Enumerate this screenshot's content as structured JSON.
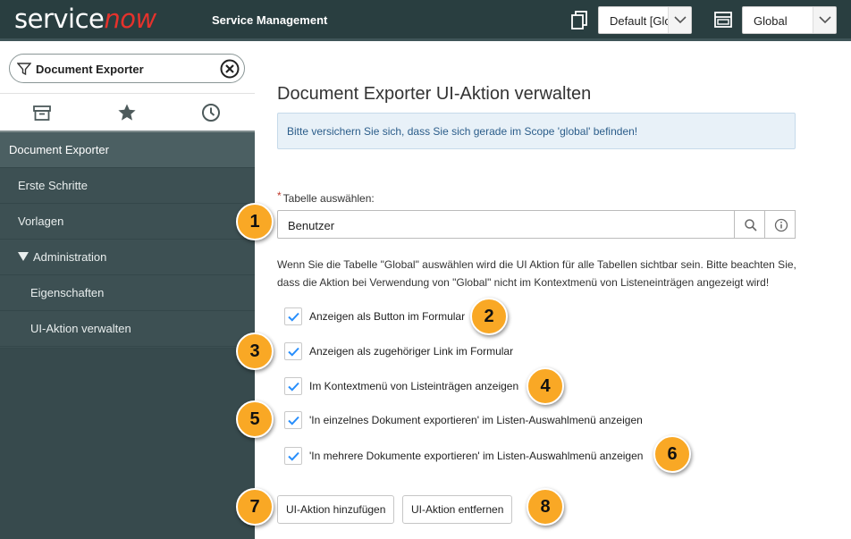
{
  "header": {
    "logo_prefix": "service",
    "logo_suffix": "now",
    "app_title": "Service Management",
    "update_set_value": "Default [Glo",
    "scope_value": "Global"
  },
  "sidebar": {
    "filter_value": "Document Exporter",
    "tabs": [
      "archive-icon",
      "favorites-star-icon",
      "history-clock-icon"
    ],
    "items": [
      {
        "label": "Document Exporter"
      },
      {
        "label": "Erste Schritte"
      },
      {
        "label": "Vorlagen"
      },
      {
        "label": "Administration"
      },
      {
        "label": "Eigenschaften"
      },
      {
        "label": "UI-Aktion verwalten"
      }
    ]
  },
  "main": {
    "title": "Document Exporter UI-Aktion verwalten",
    "info_message": "Bitte versichern Sie sich, dass Sie sich gerade im Scope 'global' befinden!",
    "table_label": "Tabelle auswählen:",
    "required_marker": "*",
    "table_value": "Benutzer",
    "hint_text": "Wenn Sie die Tabelle \"Global\" auswählen wird die UI Aktion für alle Tabellen sichtbar sein. Bitte beachten Sie, dass die Aktion bei Verwendung von \"Global\" nicht im Kontextmenü von Listeneinträgen angezeigt wird!",
    "checkboxes": [
      {
        "label": "Anzeigen als Button im Formular",
        "checked": true
      },
      {
        "label": "Anzeigen als zugehöriger Link im Formular",
        "checked": true
      },
      {
        "label": "Im Kontextmenü von Listeinträgen anzeigen",
        "checked": true
      },
      {
        "label": "'In einzelnes Dokument exportieren' im Listen-Auswahlmenü anzeigen",
        "checked": true
      },
      {
        "label": "'In mehrere Dokumente exportieren' im Listen-Auswahlmenü anzeigen",
        "checked": true
      }
    ],
    "add_button": "UI-Aktion hinzufügen",
    "remove_button": "UI-Aktion entfernen"
  },
  "callouts": [
    "1",
    "2",
    "3",
    "4",
    "5",
    "6",
    "7",
    "8"
  ],
  "colors": {
    "header_bg": "#293e40",
    "sidebar_bg": "#3d5053",
    "brand_red": "#e5322c",
    "check_blue": "#278efc",
    "callout": "#f9a825"
  }
}
